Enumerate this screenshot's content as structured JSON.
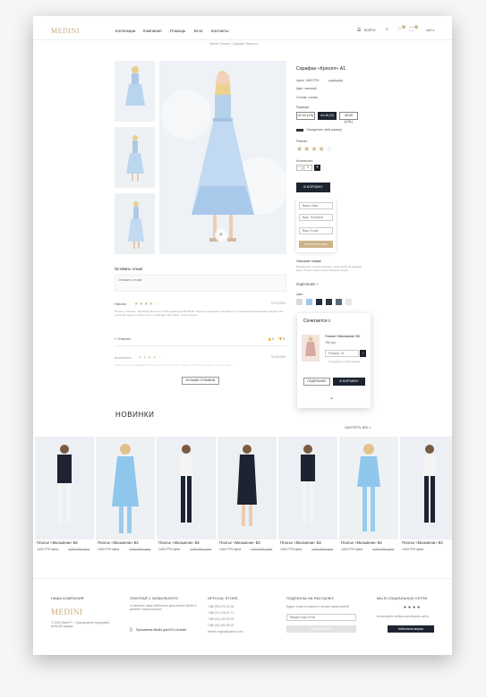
{
  "header": {
    "logo": "MEDINI",
    "nav": [
      "Коллекции",
      "Компания",
      "Помощь",
      "Блог",
      "Контакты"
    ],
    "login": "ВОЙТИ",
    "currency": "UAH ▾",
    "wishlist_count": "0",
    "cart_count": "0"
  },
  "breadcrumb": "Medini / Платья / Сарафан «Креолл» ...",
  "product": {
    "title": "Сарафан «Креолл» А1",
    "price_label": "Цена: 1480 ГРН",
    "old_price": "1 880 ГРН",
    "size_label": "Цвет: светлый",
    "material": "Состав: хлопок",
    "sizes_label": "Размеры:",
    "sizes": [
      "42-44 (XS)",
      "44-46 (S)",
      "48-50 (L/XL)"
    ],
    "size_guide": "Определить свой размер",
    "rating_label": "Рейтинг:",
    "qty_label": "Количество:",
    "qty": "1",
    "add_to_cart": "В КОРЗИНУ",
    "form_name": "Ваше Имя",
    "form_phone": "Ваш Телефон",
    "form_email": "Ваш Email",
    "quick_order": "КУПИТЬ В 1 КЛИК",
    "desc_title": "Описание товара:",
    "desc_text": "Воздушный летний сарафан, идеальный на каждый день. Лёгкая ткань и женственный силуэт.",
    "more": "ПОДРОБНЕЕ +",
    "color_label": "Цвет:",
    "colors": [
      "#d9d9d9",
      "#9cc7e8",
      "#1f2b3c",
      "#2c3540",
      "#596a7a",
      "#e6e6e6"
    ]
  },
  "reviews": {
    "leave_label": "Оставить отзыв:",
    "placeholder": "Оставить отзыв",
    "items": [
      {
        "author": "Наталя",
        "date": "01.03.2019",
        "text": "Платье отличное. Заказала 46 на рост 168 параметры 89-69-98. Подошло идеально. Легкий и от утреннего вдоха начиная следом. Кот хороший нужен к этому стиль и облачает как юбкой, а не в платье.",
        "likes": "2",
        "dislikes": "0",
        "reply": "Ответить"
      },
      {
        "author": "Анастасия",
        "date": "02.08.2019",
        "text": "Замечательный сарафан! Заказала 44 на рост 170, подошло. Приятная ткань и хорошо сидит.",
        "likes": "",
        "dislikes": "",
        "reply": ""
      }
    ],
    "more": "БОЛЬШЕ ОТЗЫВОВ"
  },
  "combo": {
    "title": "Сочетается с",
    "item_title": "Платье «Мальвени» В2",
    "item_price": "790 грн.",
    "size_select": "Размер: М",
    "size_guide": "Определить свой размер",
    "details": "ПОДРОБНЕЕ",
    "add": "В КОРЗИНУ"
  },
  "new_section": {
    "title": "НОВИНКИ",
    "see_all": "СМОТРЕТЬ ВСЕ »",
    "items": [
      {
        "title": "Платье «Мальвени» В2",
        "price": "1440 ГРН Цена",
        "old": "1780 ГРН Цена"
      },
      {
        "title": "Платье «Мальвени» В2",
        "price": "1440 ГРН Цена",
        "old": "1780 ГРН Цена"
      },
      {
        "title": "Платье «Мальвени» В2",
        "price": "1440 ГРН Цена",
        "old": "1780 ГРН Цена"
      },
      {
        "title": "Платье «Мальвени» В2",
        "price": "1440 ГРН Цена",
        "old": "1780 ГРН Цена"
      },
      {
        "title": "Платье «Мальвени» В2",
        "price": "1440 ГРН Цена",
        "old": "1780 ГРН Цена"
      },
      {
        "title": "Платье «Мальвени» В2",
        "price": "1440 ГРН Цена",
        "old": "1780 ГРН Цена"
      },
      {
        "title": "Платье «Мальвени» В2",
        "price": "1440 ГРН Цена",
        "old": "1780 ГРН Цена"
      }
    ]
  },
  "footer": {
    "company_title": "НАША КОМПАНИЯ",
    "logo": "MEDINI",
    "company_text": "© 2018 Medini™ – Производство брендовой женской одежды",
    "mobile_title": "ПОКУПАЙ С МОБИЛЬНОГО",
    "mobile_text": "Установите наше мобильное приложение Medini и делайте покупки быстро",
    "app": "Приложение Medini для iOS и Android",
    "store_title": "OFFICIAL STORE",
    "phones": [
      "+380 (99) 374-42-04",
      "+380 (67) 476-57-71",
      "+380 (63) 142-26-33",
      "+380 (50) 350-98-15"
    ],
    "email": "medini.original@yahoo.com",
    "subscribe_title": "ПОДПИСКА НА РАССЫЛКУ",
    "subscribe_text": "Будьте в курсе новинок и лучших предложений",
    "email_placeholder": "Введите ваш Email",
    "subscribe_btn": "ПОДПИСАТЬСЯ",
    "social_title": "МЫ В СОЦИАЛЬНЫХ СЕТЯХ",
    "social_text": "Используйте мобильную версию сайта",
    "mobile_btn": "Мобильная версия"
  }
}
